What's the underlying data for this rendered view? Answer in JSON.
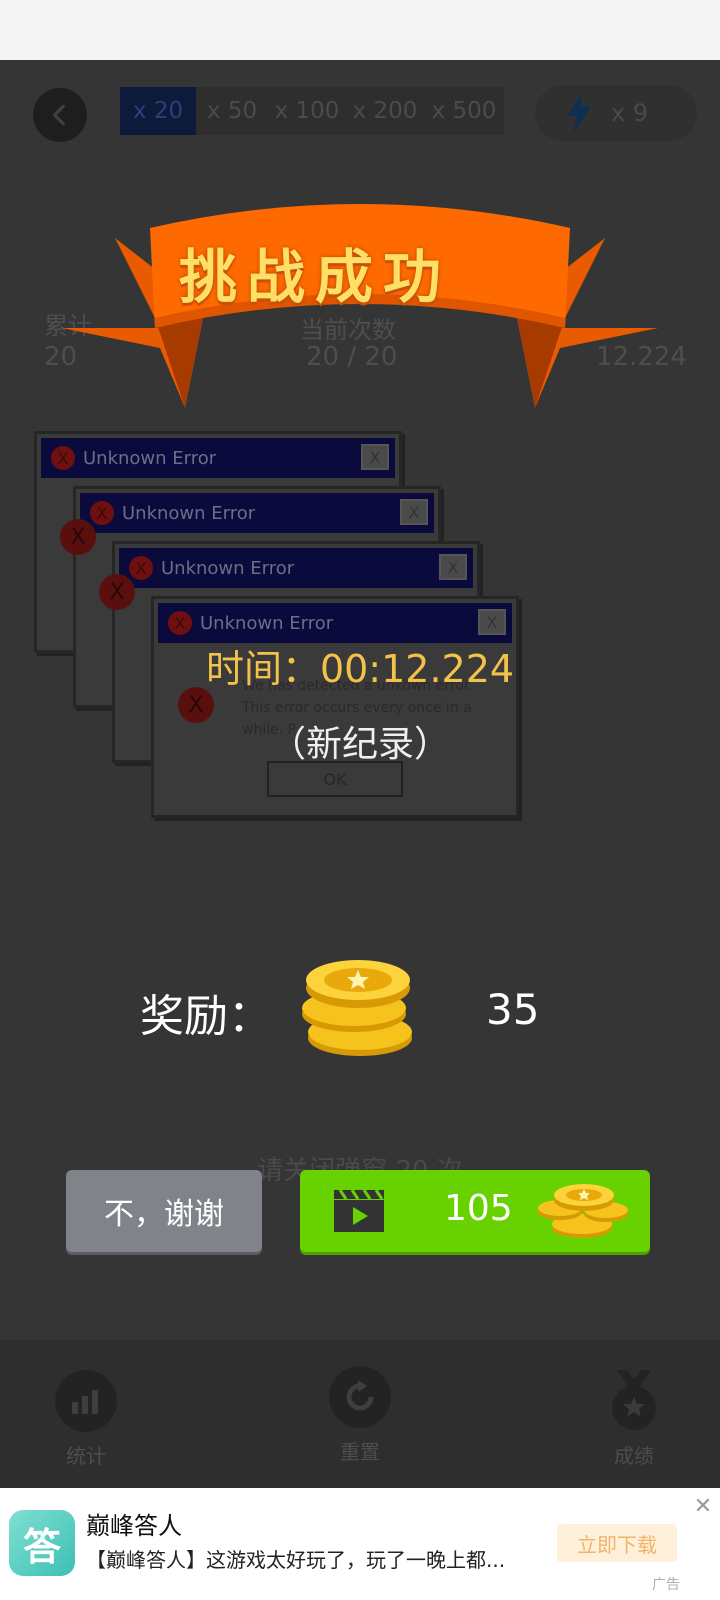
{
  "header": {
    "multipliers": [
      "x 20",
      "x 50",
      "x 100",
      "x 200",
      "x 500"
    ],
    "active_multiplier_index": 0,
    "energy_count": "x 9"
  },
  "background_stats": {
    "left_label": "累计",
    "left_value": "20",
    "center_label": "当前次数",
    "center_value": "20 / 20",
    "right_value": "12.224"
  },
  "result": {
    "banner_title": "挑战成功",
    "time_text": "时间：00:12.224",
    "record_text": "（新纪录）"
  },
  "error_window": {
    "title": "Unknown Error",
    "close_label": "X",
    "icon_label": "X",
    "message": "We has detected a unkown error. This error occurs every once in a while. P",
    "ok_label": "OK"
  },
  "reward": {
    "label": "奖励：",
    "amount": "35"
  },
  "hint_text": "请关闭弹窗 20 次",
  "buttons": {
    "decline_label": "不，谢谢",
    "video_reward": "105"
  },
  "toolbar": {
    "stats_label": "统计",
    "reset_label": "重置",
    "achievements_label": "成绩"
  },
  "ad": {
    "icon_char": "答",
    "title": "巅峰答人",
    "description": "【巅峰答人】这游戏太好玩了，玩了一晚上都...",
    "download_label": "立即下载",
    "close_label": "✕",
    "tag": "广告"
  },
  "colors": {
    "banner_orange": "#ff6a00",
    "title_yellow": "#ffe066",
    "time_gold": "#f3c24a",
    "video_button_green": "#67d200",
    "decline_button_gray": "#80848a"
  }
}
